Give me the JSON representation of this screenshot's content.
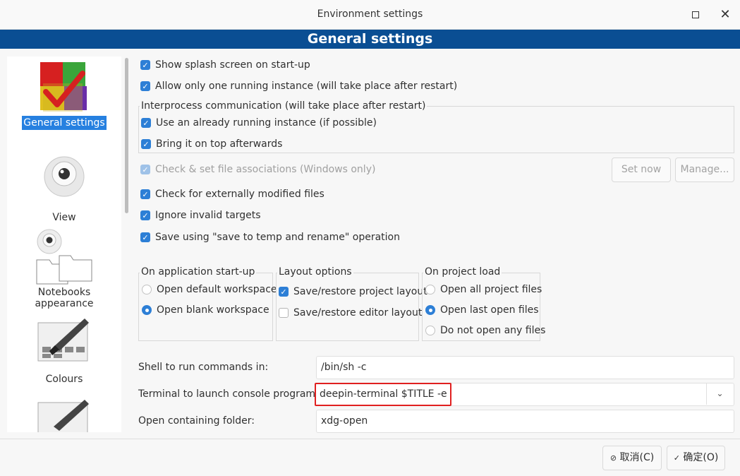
{
  "window": {
    "title": "Environment settings"
  },
  "banner": {
    "title": "General settings"
  },
  "sidebar": {
    "items": [
      {
        "label": "General settings",
        "icon": "general-settings-icon"
      },
      {
        "label": "View",
        "icon": "view-eye-icon"
      },
      {
        "label": "Notebooks appearance",
        "icon": "notebooks-folders-icon"
      },
      {
        "label": "Colours",
        "icon": "colours-palette-icon"
      }
    ]
  },
  "general": {
    "show_splash": "Show splash screen on start-up",
    "single_instance": "Allow only one running instance (will take place after restart)",
    "ipc_title": "Interprocess communication (will take place after restart)",
    "use_running": "Use an already running instance (if possible)",
    "bring_top": "Bring it on top afterwards",
    "file_assoc": "Check & set file associations (Windows only)",
    "set_now": "Set now",
    "manage": "Manage...",
    "ext_modified": "Check for externally modified files",
    "ignore_invalid": "Ignore invalid targets",
    "save_temp": "Save using \"save to temp and rename\" operation"
  },
  "startup": {
    "title": "On application start-up",
    "opt1": "Open default workspace",
    "opt2": "Open blank workspace"
  },
  "layout": {
    "title": "Layout options",
    "opt1": "Save/restore project layout",
    "opt2": "Save/restore editor layout"
  },
  "project": {
    "title": "On project load",
    "opt1": "Open all project files",
    "opt2": "Open last open files",
    "opt3": "Do not open any files"
  },
  "fields": {
    "shell_label": "Shell to run commands in:",
    "shell_value": "/bin/sh -c",
    "terminal_label": "Terminal to launch console programs:",
    "terminal_value": "deepin-terminal $TITLE -e",
    "folder_label": "Open containing folder:",
    "folder_value": "xdg-open"
  },
  "footer": {
    "cancel": "取消(C)",
    "ok": "确定(O)"
  },
  "colors": {
    "banner": "#0a4e93",
    "accent": "#2d7fd6",
    "highlight": "#e02020"
  }
}
